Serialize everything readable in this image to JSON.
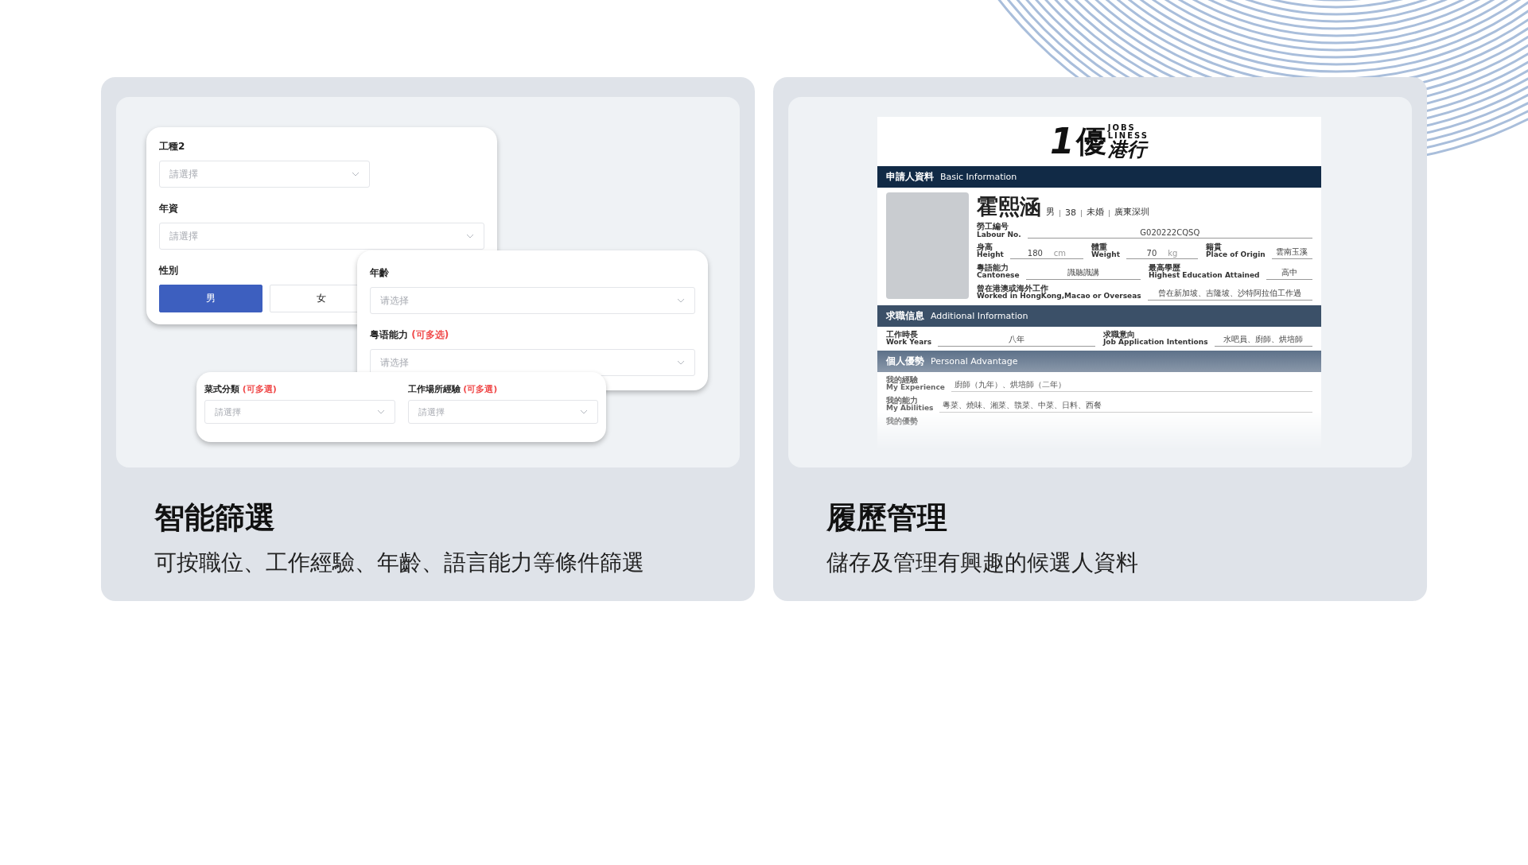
{
  "features": [
    {
      "kind": "filter",
      "title": "智能篩選",
      "subtitle": "可按職位、工作經驗、年齡、語言能力等條件篩選",
      "forms": [
        {
          "fields": [
            {
              "kind": "select",
              "label": "工種2",
              "placeholder": "請選擇",
              "wide": false
            },
            {
              "kind": "select",
              "label": "年資",
              "placeholder": "請選擇",
              "wide": true
            },
            {
              "kind": "toggle",
              "label": "性別",
              "options": [
                {
                  "label": "男",
                  "selected": true
                },
                {
                  "label": "女",
                  "selected": false
                }
              ]
            }
          ]
        },
        {
          "fields": [
            {
              "kind": "select",
              "label": "年齡",
              "placeholder": "请选择",
              "wide": true
            },
            {
              "kind": "select",
              "label": "粤语能力",
              "note": "(可多选)",
              "placeholder": "请选择",
              "wide": true
            }
          ]
        },
        {
          "fields": [
            {
              "kind": "select",
              "label": "菜式分類",
              "note": "(可多選)",
              "placeholder": "請選擇",
              "wide": true
            },
            {
              "kind": "select",
              "label": "工作場所經驗",
              "note": "(可多選)",
              "placeholder": "請選擇",
              "wide": true
            }
          ]
        }
      ]
    },
    {
      "kind": "resume",
      "title": "履歷管理",
      "subtitle": "儲存及管理有興趣的候選人資料",
      "resume": {
        "logo": {
          "digit": "1",
          "mark": "優",
          "name": "港行",
          "tag_top": "JOBS",
          "tag_bottom": "LINESS"
        },
        "sections": [
          {
            "kind": "basic",
            "title": "申請人資料",
            "title_en": "Basic Information",
            "name": "霍熙涵",
            "facts": [
              "男",
              "38",
              "未婚",
              "廣東深圳"
            ],
            "rows": [
              [
                {
                  "zh": "勞工編号",
                  "en": "Labour No.",
                  "value": "G020222CQSQ"
                }
              ],
              [
                {
                  "zh": "身高",
                  "en": "Height",
                  "value": "180",
                  "unit": "cm"
                },
                {
                  "zh": "體重",
                  "en": "Weight",
                  "value": "70",
                  "unit": "kg"
                },
                {
                  "zh": "籍貫",
                  "en": "Place of Origin",
                  "value": "雲南玉溪"
                }
              ],
              [
                {
                  "zh": "粵語能力",
                  "en": "Cantonese",
                  "value": "識聽識講"
                },
                {
                  "zh": "最高學歷",
                  "en": "Highest Education Attained",
                  "value": "高中"
                }
              ],
              [
                {
                  "zh": "曾在港澳或海外工作",
                  "en": "Worked in HongKong,Macao or Overseas",
                  "value": "曾在新加坡、吉隆坡、沙特阿拉伯工作過"
                }
              ]
            ]
          },
          {
            "kind": "additional",
            "title": "求職信息",
            "title_en": "Additional Information",
            "rows": [
              [
                {
                  "zh": "工作時長",
                  "en": "Work Years",
                  "value": "八年"
                },
                {
                  "zh": "求職意向",
                  "en": "Job Application Intentions",
                  "value": "水吧員、廚師、烘培師"
                }
              ]
            ]
          },
          {
            "kind": "personal",
            "title": "個人優勢",
            "title_en": "Personal Advantage",
            "rows": [
              [
                {
                  "zh": "我的經驗",
                  "en": "My Experience",
                  "value": "廚師（九年）、烘培師（二年）"
                }
              ],
              [
                {
                  "zh": "我的能力",
                  "en": "My Abilities",
                  "value": "粵菜、燒味、湘菜、贛菜、中菜、日料、西餐"
                }
              ],
              [
                {
                  "zh": "我的優勢"
                }
              ]
            ]
          }
        ]
      }
    }
  ]
}
